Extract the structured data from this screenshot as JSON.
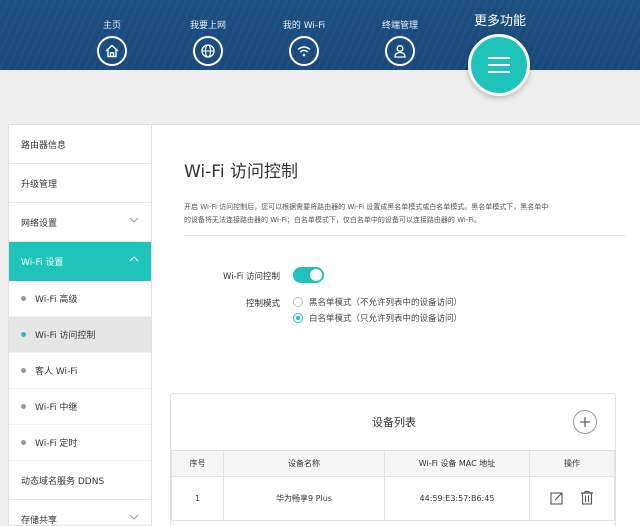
{
  "nav": {
    "items": [
      {
        "label": "主页",
        "icon": "home-icon"
      },
      {
        "label": "我要上网",
        "icon": "globe-icon"
      },
      {
        "label": "我的 Wi-Fi",
        "icon": "wifi-icon"
      },
      {
        "label": "终端管理",
        "icon": "user-icon"
      }
    ],
    "more_label": "更多功能",
    "more_icon": "menu-icon"
  },
  "sidebar": {
    "items": [
      {
        "label": "路由器信息"
      },
      {
        "label": "升级管理"
      },
      {
        "label": "网络设置"
      },
      {
        "label": "Wi-Fi 设置"
      }
    ],
    "sub_items": [
      {
        "label": "Wi-Fi 高级"
      },
      {
        "label": "Wi-Fi 访问控制"
      },
      {
        "label": "客人 Wi-Fi"
      },
      {
        "label": "Wi-Fi 中继"
      },
      {
        "label": "Wi-Fi 定时"
      }
    ],
    "bottom_items": [
      {
        "label": "动态域名服务 DDNS"
      },
      {
        "label": "存储共享"
      }
    ]
  },
  "main": {
    "title": "Wi-Fi 访问控制",
    "description_line1": "开启 Wi-Fi 访问控制后，您可以根据需要将路由器的 Wi-Fi 设置成黑名单模式或白名单模式。黑名单模式下，黑名单中",
    "description_line2": "的设备将无法连接路由器的 Wi-Fi；白名单模式下，仅白名单中的设备可以连接路由器的 Wi-Fi。",
    "toggle_label": "Wi-Fi 访问控制",
    "toggle_on": true,
    "mode_label": "控制模式",
    "mode_options": [
      {
        "label": "黑名单模式（不允许列表中的设备访问）",
        "checked": false
      },
      {
        "label": "白名单模式（只允许列表中的设备访问）",
        "checked": true
      }
    ]
  },
  "device_list": {
    "title": "设备列表",
    "columns": [
      "序号",
      "设备名称",
      "Wi-Fi 设备 MAC 地址",
      "操作"
    ],
    "rows": [
      {
        "index": "1",
        "name": "华为畅享9 Plus",
        "mac": "44:59:E3:57:B6:45"
      }
    ]
  },
  "colors": {
    "header_bg": "#1c4e80",
    "accent": "#1ec3ba"
  }
}
